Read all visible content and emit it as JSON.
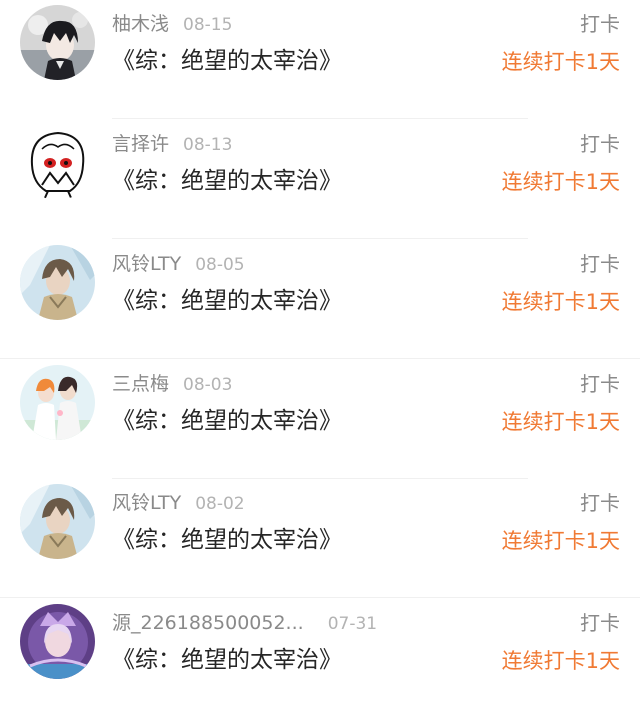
{
  "checkins": [
    {
      "username": "柚木浅",
      "date": "08-15",
      "book_title": "《综：绝望的太宰治》",
      "action_label": "打卡",
      "streak_label": "连续打卡1天",
      "avatar_icon": "anime-boy-dark-hair-avatar"
    },
    {
      "username": "言择许",
      "date": "08-13",
      "book_title": "《综：绝望的太宰治》",
      "action_label": "打卡",
      "streak_label": "连续打卡1天",
      "avatar_icon": "sketch-face-red-eyes-avatar"
    },
    {
      "username": "风铃LTY",
      "date": "08-05",
      "book_title": "《综：绝望的太宰治》",
      "action_label": "打卡",
      "streak_label": "连续打卡1天",
      "avatar_icon": "anime-character-blue-avatar"
    },
    {
      "username": "三点梅",
      "date": "08-03",
      "book_title": "《综：绝望的太宰治》",
      "action_label": "打卡",
      "streak_label": "连续打卡1天",
      "avatar_icon": "anime-couple-white-avatar"
    },
    {
      "username": "风铃LTY",
      "date": "08-02",
      "book_title": "《综：绝望的太宰治》",
      "action_label": "打卡",
      "streak_label": "连续打卡1天",
      "avatar_icon": "anime-character-blue-avatar"
    },
    {
      "username": "源_226188500052...",
      "date": "07-31",
      "book_title": "《综：绝望的太宰治》",
      "action_label": "打卡",
      "streak_label": "连续打卡1天",
      "avatar_icon": "anime-purple-crown-avatar"
    }
  ],
  "colors": {
    "streak": "#f07a34",
    "username": "#8a8a8a",
    "date": "#b3b3b3",
    "title": "#262626",
    "divider": "#f0f0f0"
  }
}
